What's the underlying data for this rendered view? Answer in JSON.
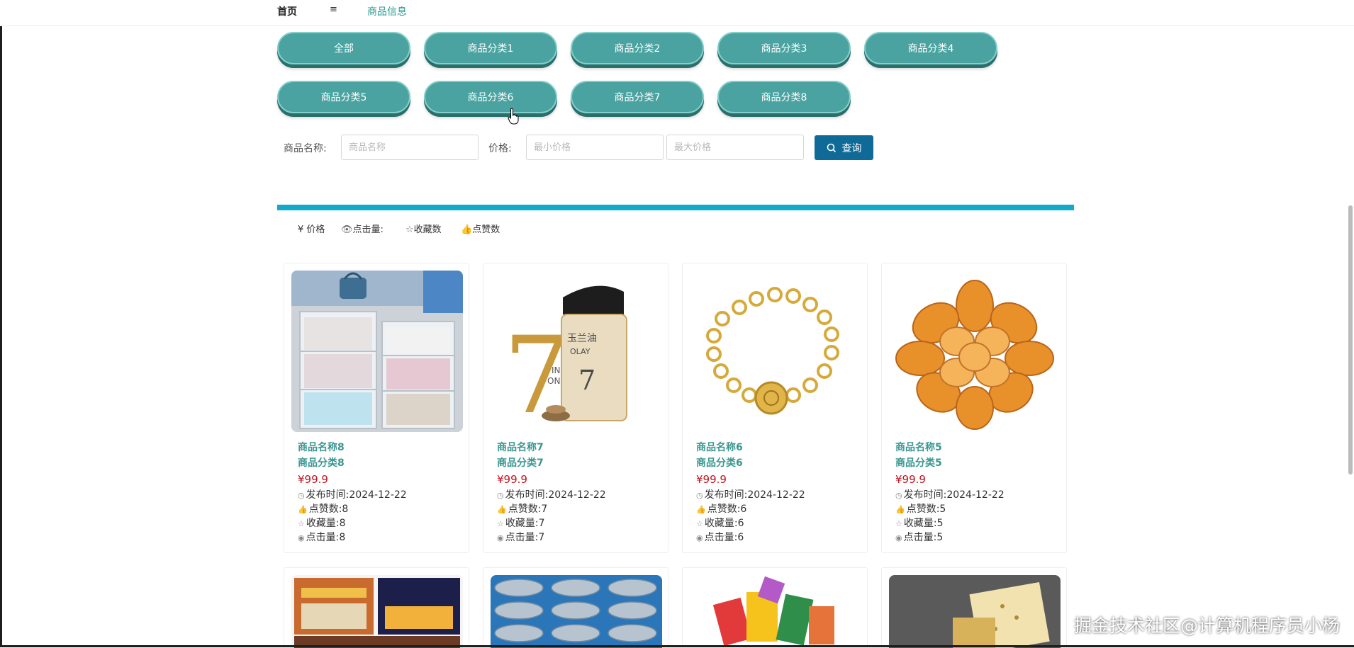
{
  "nav": {
    "home": "首页",
    "separator": "≡",
    "current": "商品信息"
  },
  "categories": [
    "全部",
    "商品分类1",
    "商品分类2",
    "商品分类3",
    "商品分类4",
    "商品分类5",
    "商品分类6",
    "商品分类7",
    "商品分类8"
  ],
  "search": {
    "name_label": "商品名称:",
    "name_placeholder": "商品名称",
    "price_label": "价格:",
    "min_placeholder": "最小价格",
    "max_placeholder": "最大价格",
    "button_label": "查询"
  },
  "sort_options": [
    {
      "icon": "yen-icon",
      "label": "¥ 价格"
    },
    {
      "icon": "eye-icon",
      "label": "点击量:"
    },
    {
      "icon": "star-icon",
      "label": "收藏数"
    },
    {
      "icon": "thumbs-up-icon",
      "label": "点赞数"
    }
  ],
  "field_labels": {
    "time": "发布时间:",
    "likes": "点赞数:",
    "favorites": "收藏量:",
    "clicks": "点击量:"
  },
  "products": [
    {
      "name": "商品名称8",
      "category": "商品分类8",
      "price": "¥99.9",
      "time": "2024-12-22",
      "likes": "8",
      "favorites": "8",
      "clicks": "8",
      "image": "storage-drawers"
    },
    {
      "name": "商品名称7",
      "category": "商品分类7",
      "price": "¥99.9",
      "time": "2024-12-22",
      "likes": "7",
      "favorites": "7",
      "clicks": "7",
      "image": "face-cream"
    },
    {
      "name": "商品名称6",
      "category": "商品分类6",
      "price": "¥99.9",
      "time": "2024-12-22",
      "likes": "6",
      "favorites": "6",
      "clicks": "6",
      "image": "gold-bracelet"
    },
    {
      "name": "商品名称5",
      "category": "商品分类5",
      "price": "¥99.9",
      "time": "2024-12-22",
      "likes": "5",
      "favorites": "5",
      "clicks": "5",
      "image": "dried-abalone"
    }
  ],
  "second_row_images": [
    "shopping-mall",
    "fish-tray",
    "snack-basket",
    "gift-box"
  ],
  "image_text": {
    "cream_brand_cn": "玉兰油",
    "cream_brand_en": "OLAY",
    "cream_number": "7",
    "cream_big_number": "7",
    "cream_sub1": "IN",
    "cream_sub2": "ONE"
  },
  "watermark": "掘金技术社区@计算机程序员小杨",
  "colors": {
    "pill": "#4aa3a0",
    "accent": "#2b9a94",
    "price": "#c4121e",
    "search_button": "#0f6a98",
    "divider": "#13a9c9"
  }
}
